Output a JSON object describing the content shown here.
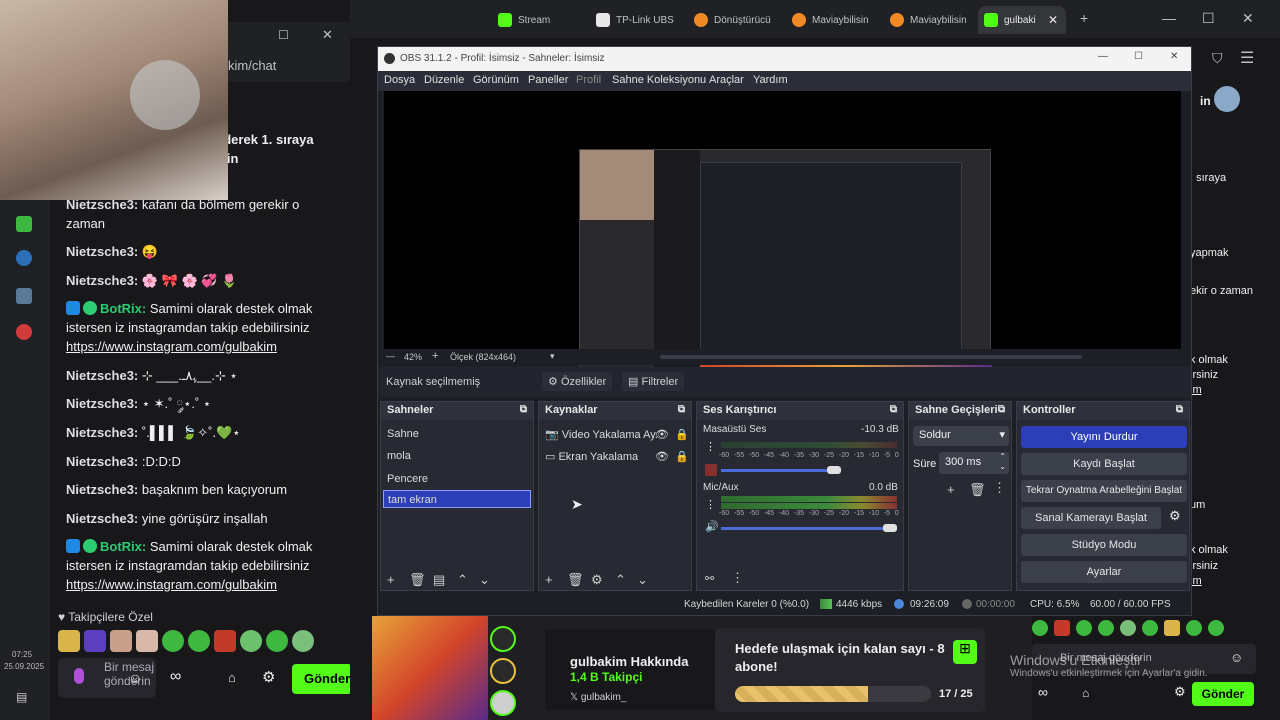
{
  "browser": {
    "tabs": [
      {
        "label": "Stream",
        "color": "#53fc18"
      },
      {
        "label": "TP-Link UBS",
        "color": "#e8e8e8"
      },
      {
        "label": "Dönüştürücü",
        "color": "#f08a24"
      },
      {
        "label": "Maviaybilisin",
        "color": "#f08a24"
      },
      {
        "label": "Maviaybilisin",
        "color": "#f08a24"
      },
      {
        "label": "gulbaki",
        "color": "#53fc18"
      }
    ],
    "new_tab": "+",
    "address": "kim/chat",
    "minimize": "—",
    "maximize": "☐",
    "close": "✕"
  },
  "chat": {
    "messages": [
      {
        "user": "",
        "text": "ederek 1. sıraya elin"
      },
      {
        "user": "Nietzsche3:",
        "text": "kafanı da bölmem gerekir o zaman"
      },
      {
        "user": "Nietzsche3:",
        "text": "😝"
      },
      {
        "user": "Nietzsche3:",
        "text": "🌸 🎀 🌸 💞 🌷"
      },
      {
        "user": "BotRix:",
        "text": "Samimi olarak destek olmak istersen iz instagramdan takip edebilirsiniz",
        "link": "https://www.instagram.com/gulbakim"
      },
      {
        "user": "Nietzsche3:",
        "text": "⊹ ___.ﮩ٨ـ__.⊹ ⋆"
      },
      {
        "user": "Nietzsche3:",
        "text": "⋆ ✶.˚ ༘⋆.˚ ⋆"
      },
      {
        "user": "Nietzsche3:",
        "text": "˚.▌▌▌ 🍃✧˚.💚⋆"
      },
      {
        "user": "Nietzsche3:",
        "text": ":D:D:D"
      },
      {
        "user": "Nietzsche3:",
        "text": "başaknım ben kaçıyorum"
      },
      {
        "user": "Nietzsche3:",
        "text": "yine görüşürz inşallah"
      },
      {
        "user": "BotRix:",
        "text": "Samimi olarak destek olmak istersen iz instagramdan takip edebilirsiniz",
        "link": "https://www.instagram.com/gulbakim"
      }
    ],
    "followers_only": "Takipçilere Özel",
    "input_placeholder": "Bir mesaj gönderin",
    "send": "Gönder",
    "clock_time": "07:25",
    "clock_date": "25.09.2025"
  },
  "obs": {
    "title": "OBS 31.1.2 - Profil: İsimsiz - Sahneler: İsimsiz",
    "menu": [
      "Dosya",
      "Düzenle",
      "Görünüm",
      "Paneller",
      "Profil",
      "Sahne Koleksiyonu",
      "Araçlar",
      "Yardım"
    ],
    "zoom": "42%",
    "scale": "Ölçek (824x464)",
    "no_source": "Kaynak seçilmemiş",
    "properties": "Özellikler",
    "filters": "Filtreler",
    "scenes_title": "Sahneler",
    "scenes": [
      "Sahne",
      "mola",
      "Pencere",
      "tam ekran"
    ],
    "sources_title": "Kaynaklar",
    "sources": [
      "Video Yakalama Ay.",
      "Ekran Yakalama"
    ],
    "mixer_title": "Ses Karıştırıcı",
    "mixer": [
      {
        "name": "Masaüstü Ses",
        "db": "-10.3 dB"
      },
      {
        "name": "Mic/Aux",
        "db": "0.0 dB"
      }
    ],
    "meter_ticks": [
      "-60",
      "-55",
      "-50",
      "-45",
      "-40",
      "-35",
      "-30",
      "-25",
      "-20",
      "-15",
      "-10",
      "-5",
      "0"
    ],
    "transitions_title": "Sahne Geçişleri",
    "transition": "Soldur",
    "duration_label": "Süre",
    "duration": "300 ms",
    "controls_title": "Kontroller",
    "controls": [
      "Yayını Durdur",
      "Kaydı Başlat",
      "Tekrar Oynatma Arabelleğini Başlat",
      "Sanal Kamerayı Başlat",
      "Stüdyo Modu",
      "Ayarlar"
    ],
    "status": {
      "dropped": "Kaybedilen Kareler 0 (%0.0)",
      "bitrate": "4446 kbps",
      "stream_time": "09:26:09",
      "rec_time": "00:00:00",
      "cpu": "CPU: 6.5%",
      "fps": "60.00 / 60.00 FPS"
    }
  },
  "stream": {
    "streamer": "gulbakim Hakkında",
    "followers": "1,4 B Takipçi",
    "social": "gulbakim_",
    "goal_text": "Hedefe ulaşmak için kalan sayı - 8 abone!",
    "goal_progress": "17 / 25",
    "goal_fraction": 0.68
  },
  "right": {
    "snippets": [
      "in",
      ". sıraya",
      "yapmak",
      "ekir o zaman",
      "k olmak",
      "irsiniz",
      "im",
      "um",
      "k olmak",
      "irsiniz",
      "im"
    ],
    "placeholder": "Bir mesaj gönderin",
    "send": "Gönder",
    "activate_title": "Windows'u Etkinleştir",
    "activate_sub": "Windows'u etkinleştirmek için Ayarlar'a gidin."
  }
}
